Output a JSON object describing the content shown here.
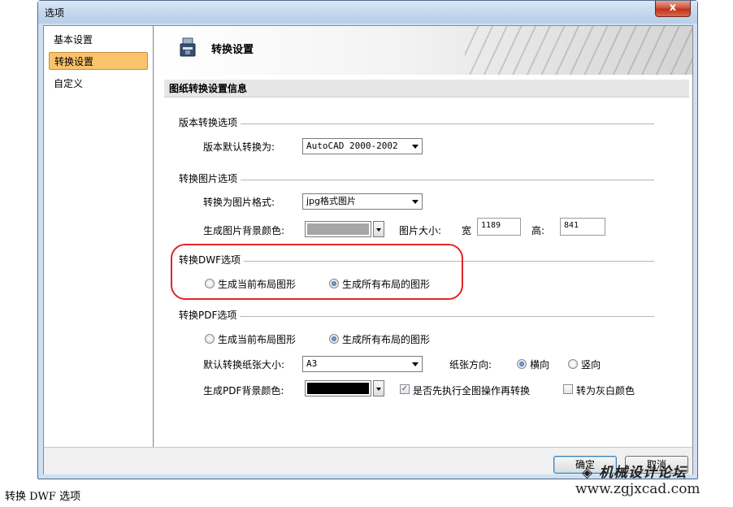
{
  "window": {
    "title": "选项",
    "close_label": "x"
  },
  "sidebar": {
    "items": [
      {
        "label": "基本设置",
        "active": false
      },
      {
        "label": "转换设置",
        "active": true
      },
      {
        "label": "自定义",
        "active": false
      }
    ]
  },
  "panel": {
    "title": "转换设置",
    "section": "图纸转换设置信息"
  },
  "version_group": {
    "title": "版本转换选项",
    "default_label": "版本默认转换为:",
    "default_value": "AutoCAD 2000-2002"
  },
  "image_group": {
    "title": "转换图片选项",
    "format_label": "转换为图片格式:",
    "format_value": "jpg格式图片",
    "bg_label": "生成图片背景颜色:",
    "bg_color": "#a6a6a6",
    "size_label": "图片大小:",
    "width_label": "宽",
    "width_value": "1189",
    "height_label": "高:",
    "height_value": "841"
  },
  "dwf_group": {
    "title": "转换DWF选项",
    "option_current": "生成当前布局图形",
    "option_all": "生成所有布局的图形",
    "selected": "all"
  },
  "pdf_group": {
    "title": "转换PDF选项",
    "option_current": "生成当前布局图形",
    "option_all": "生成所有布局的图形",
    "paper_label": "默认转换纸张大小:",
    "paper_value": "A3",
    "orient_label": "纸张方向:",
    "orient_landscape": "横向",
    "orient_portrait": "竖向",
    "bg_label": "生成PDF背景颜色:",
    "bg_color": "#000000",
    "zoom_all_label": "是否先执行全图操作再转换",
    "zoom_all_checked": true,
    "grayscale_label": "转为灰白颜色",
    "grayscale_checked": false
  },
  "buttons": {
    "ok": "确定",
    "cancel": "取消"
  },
  "caption": "转换 DWF 选项",
  "watermark": {
    "line1": "机械设计论坛",
    "line2": "www.zgjxcad.com"
  },
  "highlight_color": "#e02525"
}
